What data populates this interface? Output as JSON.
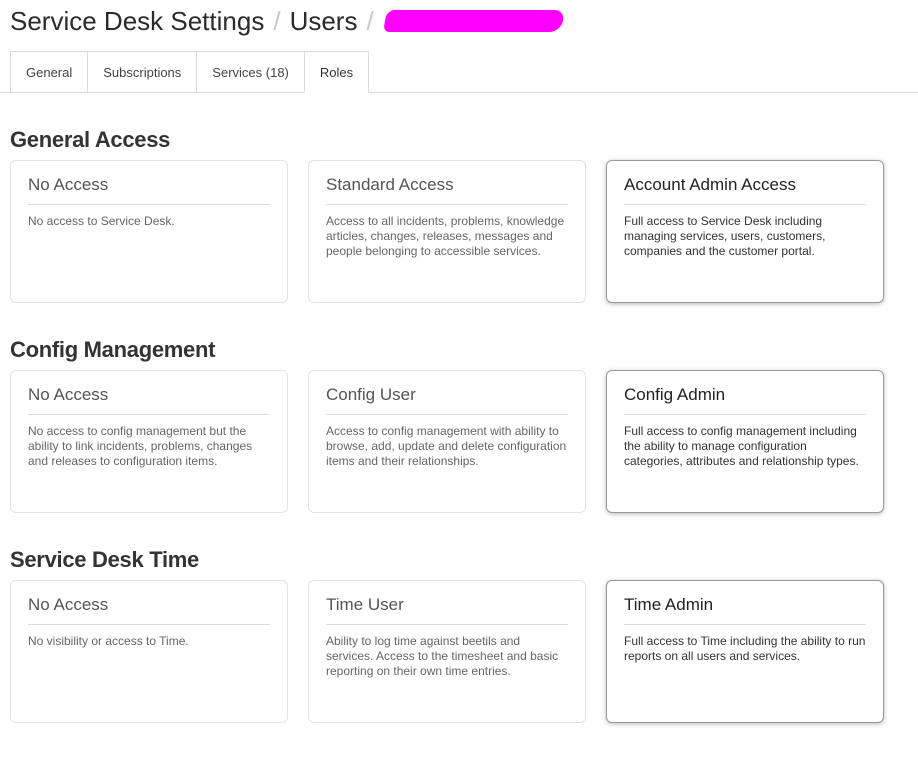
{
  "breadcrumb": {
    "root": "Service Desk Settings",
    "separator": "/",
    "section": "Users",
    "redacted_color": "#ff00ff"
  },
  "tabs": [
    {
      "label": "General",
      "active": false
    },
    {
      "label": "Subscriptions",
      "active": false
    },
    {
      "label": "Services (18)",
      "active": false
    },
    {
      "label": "Roles",
      "active": true
    }
  ],
  "sections": [
    {
      "title": "General Access",
      "cards": [
        {
          "title": "No Access",
          "description": "No access to Service Desk.",
          "selected": false
        },
        {
          "title": "Standard Access",
          "description": "Access to all incidents, problems, knowledge articles, changes, releases, messages and people belonging to accessible services.",
          "selected": false
        },
        {
          "title": "Account Admin Access",
          "description": "Full access to Service Desk including managing services, users, customers, companies and the customer portal.",
          "selected": true
        }
      ]
    },
    {
      "title": "Config Management",
      "cards": [
        {
          "title": "No Access",
          "description": "No access to config management but the ability to link incidents, problems, changes and releases to configuration items.",
          "selected": false
        },
        {
          "title": "Config User",
          "description": "Access to config management with ability to browse, add, update and delete configuration items and their relationships.",
          "selected": false
        },
        {
          "title": "Config Admin",
          "description": "Full access to config management including the ability to manage configuration categories, attributes and relationship types.",
          "selected": true
        }
      ]
    },
    {
      "title": "Service Desk Time",
      "cards": [
        {
          "title": "No Access",
          "description": "No visibility or access to Time.",
          "selected": false
        },
        {
          "title": "Time User",
          "description": "Ability to log time against beetils and services. Access to the timesheet and basic reporting on their own time entries.",
          "selected": false
        },
        {
          "title": "Time Admin",
          "description": "Full access to Time including the ability to run reports on all users and services.",
          "selected": true
        }
      ]
    }
  ]
}
